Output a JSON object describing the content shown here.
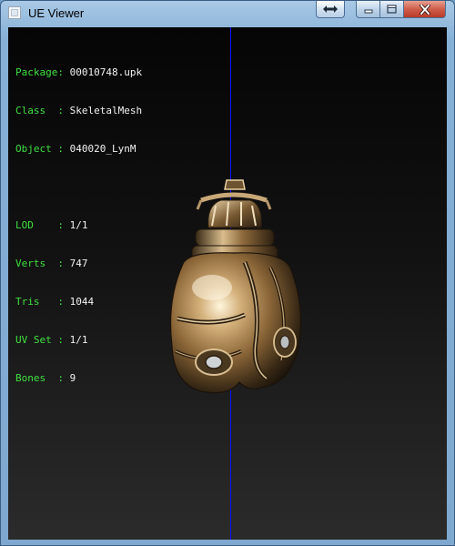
{
  "window": {
    "title": "UE Viewer",
    "caption_buttons": {
      "arrows": "double-arrow-icon",
      "minimize": "minimize-icon",
      "maximize": "maximize-icon",
      "close": "close-icon"
    }
  },
  "info": {
    "package": {
      "label": "Package: ",
      "value": "00010748.upk"
    },
    "class": {
      "label": "Class  : ",
      "value": "SkeletalMesh"
    },
    "object": {
      "label": "Object : ",
      "value": "040020_LynM"
    },
    "lod": {
      "label": "LOD    : ",
      "value": "1/1"
    },
    "verts": {
      "label": "Verts  : ",
      "value": "747"
    },
    "tris": {
      "label": "Tris   : ",
      "value": "1044"
    },
    "uvset": {
      "label": "UV Set : ",
      "value": "1/1"
    },
    "bones": {
      "label": "Bones  : ",
      "value": "9"
    }
  },
  "colors": {
    "label": "#3fe03f",
    "value": "#f2f2f2",
    "axis": "#0c14ff",
    "metal": "#b08a55"
  }
}
